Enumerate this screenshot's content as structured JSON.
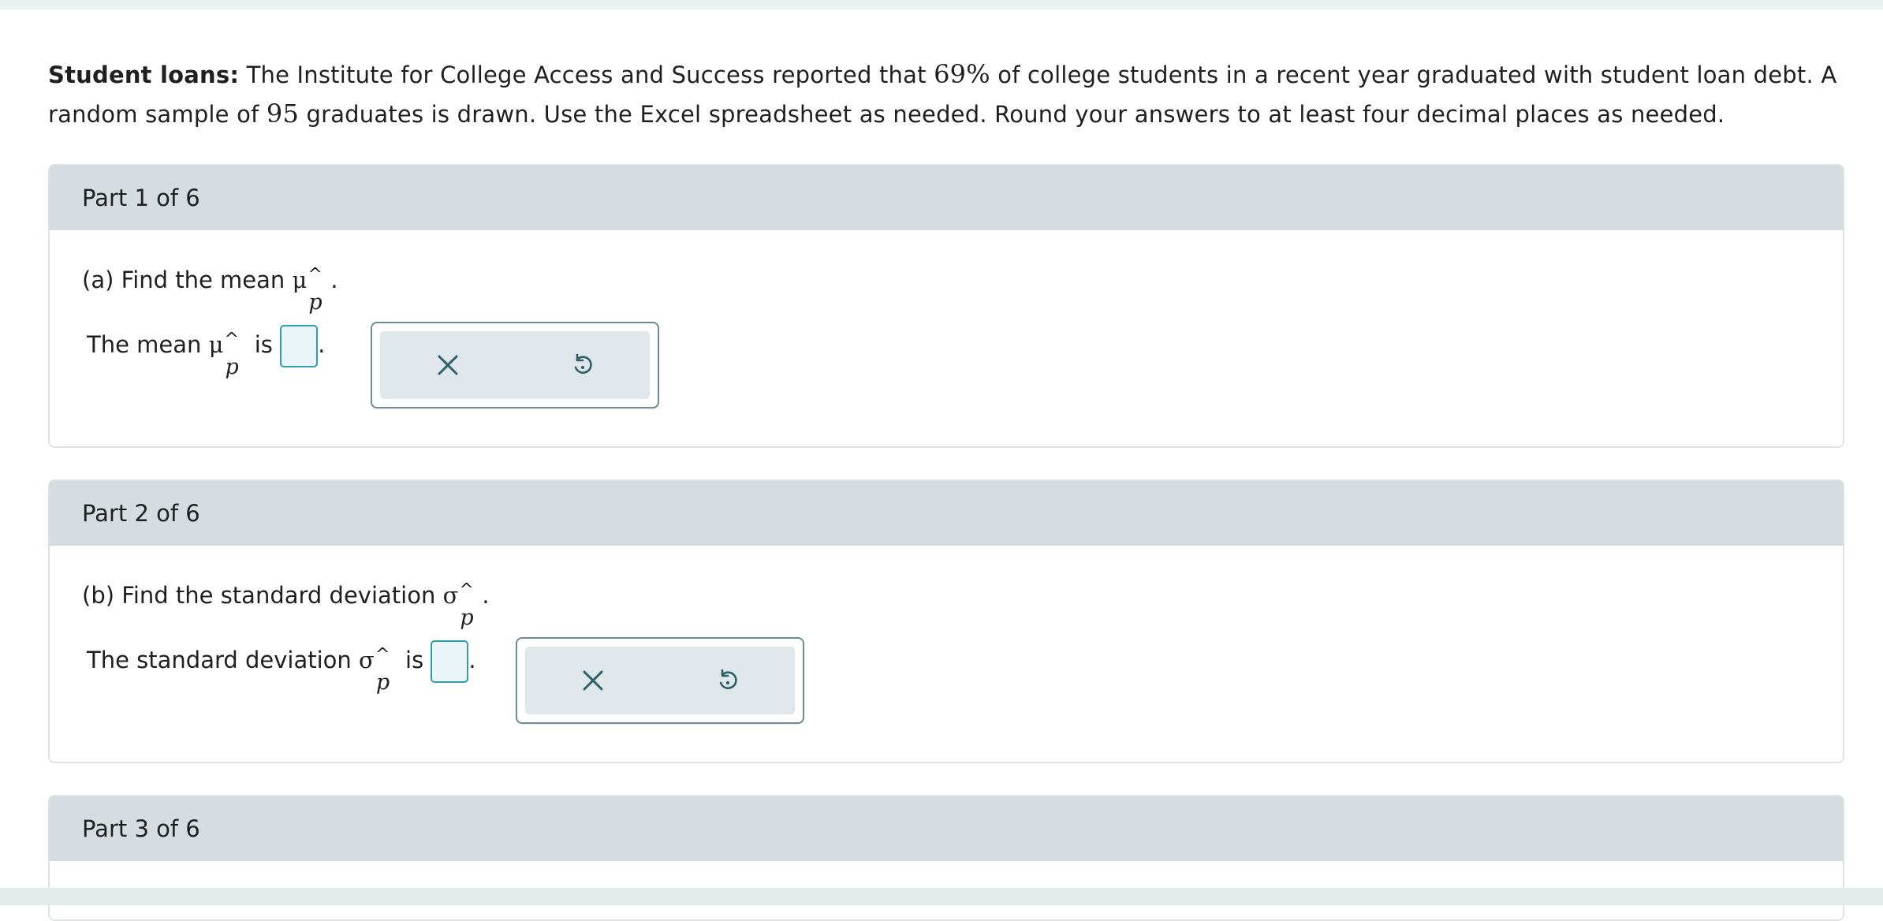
{
  "problem": {
    "title_bold": "Student loans:",
    "text_1": " The Institute for College Access and Success reported that ",
    "percent": "69%",
    "text_2": " of college students in a recent year graduated with student loan debt. A random sample of ",
    "sample_size": "95",
    "text_3": " graduates is drawn. Use the Excel spreadsheet as needed. Round your answers to at least four decimal places as needed."
  },
  "parts": [
    {
      "header": "Part 1 of 6",
      "question_prefix": "(a) Find the mean ",
      "symbol": "μ",
      "hat": "^",
      "subscript": "p",
      "question_suffix": ".",
      "answer_prefix": "The mean ",
      "answer_is": " is ",
      "answer_suffix": ".",
      "answer_value": "",
      "clear_label": "×",
      "reset_label": "↺"
    },
    {
      "header": "Part 2 of 6",
      "question_prefix": "(b) Find the standard deviation ",
      "symbol": "σ",
      "hat": "^",
      "subscript": "p",
      "question_suffix": ".",
      "answer_prefix": "The standard deviation ",
      "answer_is": " is ",
      "answer_suffix": ".",
      "answer_value": "",
      "clear_label": "×",
      "reset_label": "↺"
    },
    {
      "header": "Part 3 of 6"
    }
  ],
  "colors": {
    "header_bg": "#d5dde0",
    "input_border": "#2f9dae",
    "input_bg": "#e8f4f7",
    "icon_color": "#2f5d68"
  }
}
